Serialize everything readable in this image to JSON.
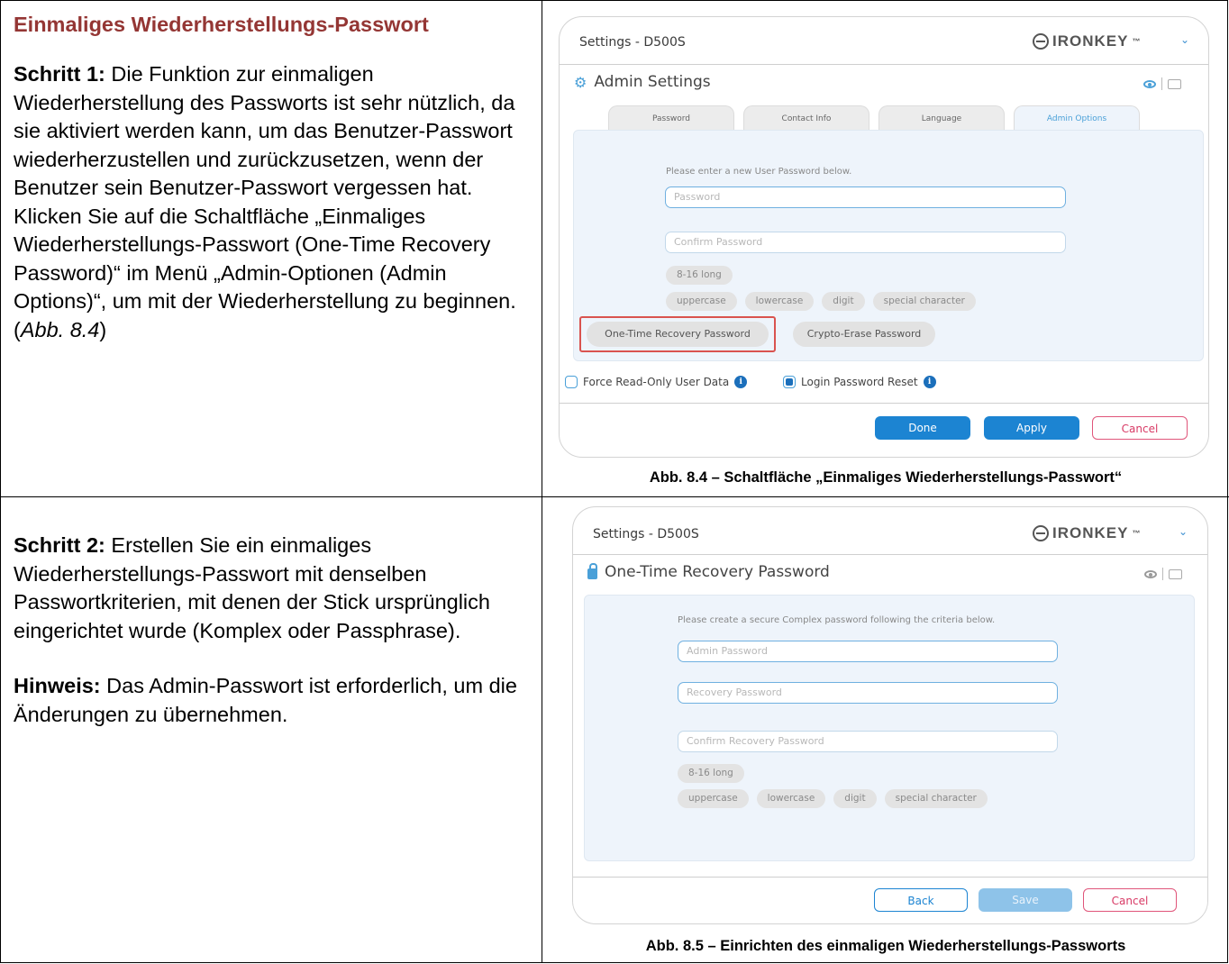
{
  "section1": {
    "title": "Einmaliges Wiederherstellungs-Passwort",
    "step_label": "Schritt 1:",
    "step_text": "Die Funktion zur einmaligen Wiederherstellung des Passworts ist sehr nützlich, da sie aktiviert werden kann, um das Benutzer-Passwort wiederherzustellen und zurückzusetzen, wenn der Benutzer sein Benutzer-Passwort vergessen hat. Klicken Sie auf die Schaltfläche „Einmaliges Wiederherstellungs-Passwort (One-Time Recovery Password)“ im Menü „Admin-Optionen (Admin Options)“, um mit der Wiederherstellung zu beginnen. (",
    "step_ref": "Abb. 8.4",
    "step_close": ")"
  },
  "section2": {
    "step_label": "Schritt 2:",
    "step_text": "Erstellen Sie ein einmaliges Wiederherstellungs-Passwort mit denselben Passwortkriterien, mit denen der Stick ursprünglich eingerichtet wurde (Komplex oder Passphrase).",
    "note_label": "Hinweis:",
    "note_text": "Das Admin-Passwort ist erforderlich, um die Änderungen zu übernehmen."
  },
  "fig1": {
    "window_title": "Settings - D500S",
    "logo": "IRONKEY",
    "logo_mark": "™",
    "chevron": "⌄",
    "heading": "Admin Settings",
    "gear": "⚙",
    "tabs": [
      "Password",
      "Contact Info",
      "Language",
      "Admin Options"
    ],
    "hint": "Please enter a new User Password below.",
    "password_placeholder": "Password",
    "confirm_placeholder": "Confirm Password",
    "chip_length": "8-16 long",
    "chips": [
      "uppercase",
      "lowercase",
      "digit",
      "special character"
    ],
    "otr_button": "One-Time Recovery Password",
    "crypto_button": "Crypto-Erase Password",
    "force_readonly": "Force Read-Only User Data",
    "force_readonly_checked": false,
    "login_reset": "Login Password Reset",
    "login_reset_checked": true,
    "done": "Done",
    "apply": "Apply",
    "cancel": "Cancel",
    "caption": "Abb. 8.4 – Schaltfläche „Einmaliges Wiederherstellungs-Passwort“"
  },
  "fig2": {
    "window_title": "Settings - D500S",
    "logo": "IRONKEY",
    "logo_mark": "™",
    "chevron": "⌄",
    "heading": "One-Time Recovery Password",
    "hint": "Please create a secure Complex password following the criteria below.",
    "admin_placeholder": "Admin Password",
    "recovery_placeholder": "Recovery Password",
    "confirm_placeholder": "Confirm Recovery Password",
    "chip_length": "8-16 long",
    "chips": [
      "uppercase",
      "lowercase",
      "digit",
      "special character"
    ],
    "back": "Back",
    "save": "Save",
    "cancel": "Cancel",
    "caption": "Abb. 8.5 – Einrichten des einmaligen Wiederherstellungs-Passworts"
  },
  "colors": {
    "title_red": "#943634",
    "accent_blue": "#1c84d2",
    "highlight_red": "#d9534f"
  }
}
